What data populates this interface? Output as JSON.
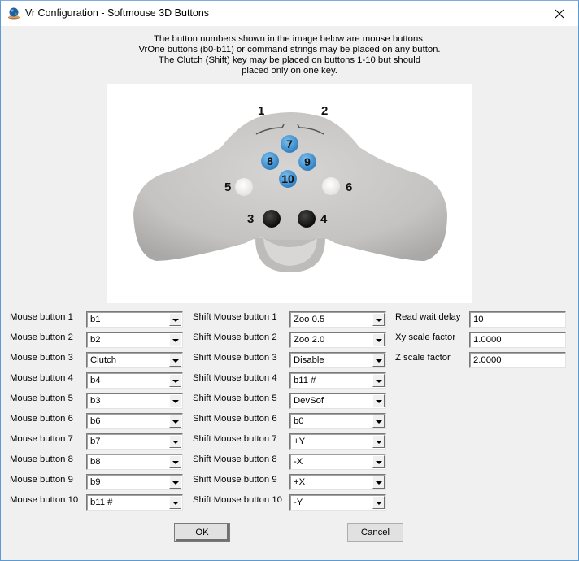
{
  "window": {
    "title": "Vr Configuration - Softmouse 3D Buttons",
    "icon": "globe-hand-icon",
    "close_icon": "close-icon"
  },
  "instructions": [
    "The button numbers shown in the image below are mouse buttons.",
    "VrOne buttons (b0-b11) or command strings may be placed on any button.",
    "The Clutch (Shift) key may be placed on buttons 1-10 but should",
    "placed only on one key."
  ],
  "mouse_image": {
    "labels": [
      "1",
      "2",
      "3",
      "4",
      "5",
      "6",
      "7",
      "8",
      "9",
      "10"
    ],
    "colors": {
      "body": "#c8c7c5",
      "blue_button": "#4b9cd9",
      "white_button": "#f8f8f6",
      "black_button": "#1a1a1a"
    }
  },
  "mouse_buttons": [
    {
      "label": "Mouse button 1",
      "value": "b1"
    },
    {
      "label": "Mouse button 2",
      "value": "b2"
    },
    {
      "label": "Mouse button 3",
      "value": "Clutch"
    },
    {
      "label": "Mouse button 4",
      "value": "b4"
    },
    {
      "label": "Mouse button 5",
      "value": "b3"
    },
    {
      "label": "Mouse button 6",
      "value": "b6"
    },
    {
      "label": "Mouse button 7",
      "value": "b7"
    },
    {
      "label": "Mouse button 8",
      "value": "b8"
    },
    {
      "label": "Mouse button 9",
      "value": "b9"
    },
    {
      "label": "Mouse button 10",
      "value": "b11 #"
    }
  ],
  "shift_mouse_buttons": [
    {
      "label": "Shift Mouse button 1",
      "value": "Zoo 0.5"
    },
    {
      "label": "Shift Mouse button 2",
      "value": "Zoo 2.0"
    },
    {
      "label": "Shift Mouse button 3",
      "value": "Disable"
    },
    {
      "label": "Shift Mouse button 4",
      "value": "b11 #"
    },
    {
      "label": "Shift Mouse button 5",
      "value": "DevSof"
    },
    {
      "label": "Shift Mouse button 6",
      "value": "b0"
    },
    {
      "label": "Shift Mouse button 7",
      "value": "+Y"
    },
    {
      "label": "Shift Mouse button 8",
      "value": "-X"
    },
    {
      "label": "Shift Mouse button 9",
      "value": "+X"
    },
    {
      "label": "Shift Mouse button 10",
      "value": "-Y"
    }
  ],
  "settings": [
    {
      "label": "Read wait delay",
      "value": "10"
    },
    {
      "label": "Xy scale factor",
      "value": "1.0000"
    },
    {
      "label": "Z scale factor",
      "value": "2.0000"
    }
  ],
  "buttons": {
    "ok": "OK",
    "cancel": "Cancel"
  }
}
